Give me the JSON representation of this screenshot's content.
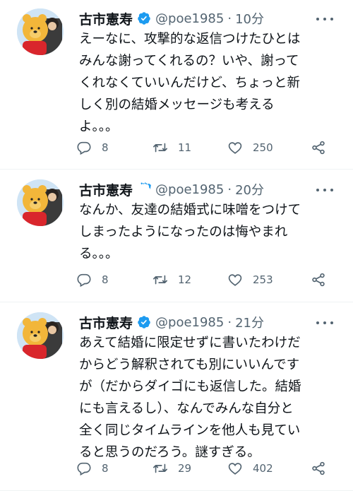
{
  "tweets": [
    {
      "name": "古市憲寿",
      "handle": "@poe1985",
      "separator": "·",
      "time": "10分",
      "lines": [
        "えーなに、攻撃的な返信つけたひとは",
        "みんな謝ってくれるの？いや、謝って",
        "くれなくていいんだけど、ちょっと新",
        "しく別の結婚メッセージも考える",
        "よ。。。"
      ],
      "replies": "8",
      "retweets": "11",
      "likes": "250"
    },
    {
      "name": "古市憲寿",
      "handle": "@poe1985",
      "separator": "·",
      "time": "20分",
      "lines": [
        "なんか、友達の結婚式に味噌をつけて",
        "しまったようになったのは悔やまれ",
        "る。。。"
      ],
      "replies": "8",
      "retweets": "12",
      "likes": "253"
    },
    {
      "name": "古市憲寿",
      "handle": "@poe1985",
      "separator": "·",
      "time": "21分",
      "lines": [
        "あえて結婚に限定せずに書いたわけだ",
        "からどう解釈されても別にいいんです",
        "が（だからダイゴにも返信した。結婚",
        "にも言えるし）、なんでみんな自分と",
        "全く同じタイムラインを他人も見てい",
        "ると思うのだろう。謎すぎる。"
      ],
      "replies": "8",
      "retweets": "29",
      "likes": "402"
    }
  ],
  "icons": {
    "reply": "reply-icon",
    "retweet": "retweet-icon",
    "like": "like-icon",
    "share": "share-icon",
    "verified": "verified-badge-icon",
    "more": "more-icon"
  },
  "colors": {
    "verified": "#1d9bf0",
    "secondary_text": "#536471",
    "divider": "#eff3f4"
  }
}
